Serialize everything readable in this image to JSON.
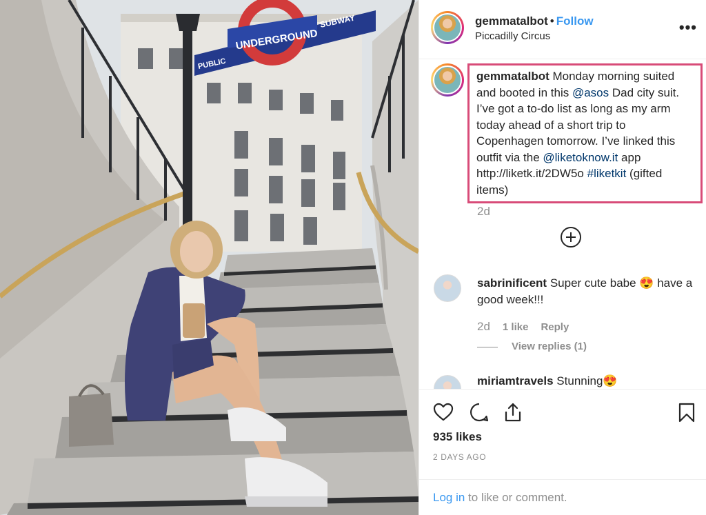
{
  "post": {
    "author": "gemmatalbot",
    "separator": "•",
    "follow_label": "Follow",
    "location": "Piccadilly Circus",
    "more_icon": "more-options-icon",
    "more_glyph": "•••"
  },
  "photo": {
    "sign_roundel": "UNDERGROUND",
    "sign_left": "PUBLIC",
    "sign_right": "SUBWAY"
  },
  "caption": {
    "author": "gemmatalbot",
    "text_1": " Monday morning suited and booted in this ",
    "mention_1": "@asos",
    "text_2": " Dad city suit. I’ve got a to-do list as long as my arm today ahead of a short trip to Copenhagen tomorrow. I’ve linked this outfit via the ",
    "mention_2": "@liketoknow.it",
    "text_3": " app http://liketk.it/2DW5o ",
    "hashtag": "#liketkit",
    "text_4": " (gifted items)",
    "age": "2d"
  },
  "comments": [
    {
      "author": "sabrinificent",
      "text": " Super cute babe 😍  have a good week!!!",
      "age": "2d",
      "likes": "1 like",
      "reply_label": "Reply",
      "view_replies": "View replies (1)"
    },
    {
      "author": "miriamtravels",
      "text": " Stunning😍"
    }
  ],
  "actions": {
    "likes": "935 likes",
    "date": "2 DAYS AGO",
    "login_link": "Log in",
    "login_rest": " to like or comment."
  },
  "colors": {
    "accent": "#3897f0",
    "caption_highlight": "#d84b78",
    "muted": "#8e8e8e"
  }
}
